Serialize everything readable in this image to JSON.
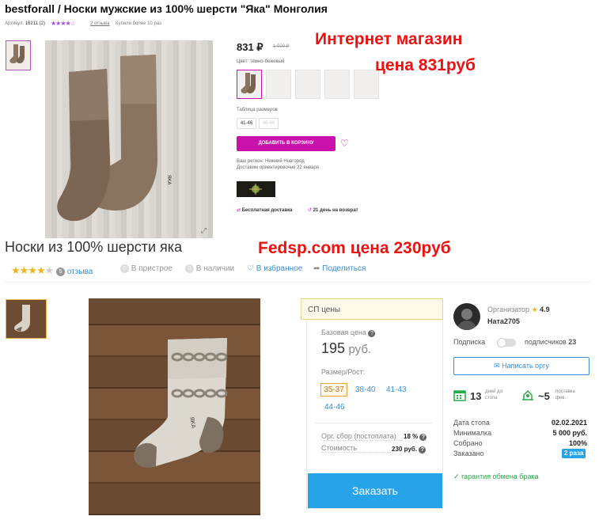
{
  "wb": {
    "title": "bestforall / Носки мужские из 100% шерсти \"Яка\" Монголия",
    "article_label": "Артикул:",
    "article_value": "16211 (2)",
    "reviews_link": "2 отзыва",
    "bought_label": "Купили более 10 раз",
    "price": "831 ₽",
    "old_price": "1 000 ₽",
    "color_label": "Цвет: темно-бежевый",
    "size_table_label": "Таблица размеров",
    "sizes": [
      "41-46",
      "46-48"
    ],
    "add_to_cart": "ДОБАВИТЬ В КОРЗИНУ",
    "region_line": "Ваш регион: Нижний Новгород",
    "delivery_line": "Доставим ориентировочно 22 января",
    "free_delivery": "Бесплатная доставка",
    "return_days": "21 день на возврат",
    "colors": {
      "accent": "#cb11ab"
    }
  },
  "annotations": {
    "shop_line1": "Интернет магазин",
    "shop_line2": "цена 831руб",
    "fedsp_line": "Fedsp.com    цена 230руб"
  },
  "fedsp": {
    "product_title": "Носки из 100% шерсти яка",
    "reviews_count": "5",
    "reviews_label": "отзыва",
    "pristroy_count": "0",
    "pristroy_label": "В пристрое",
    "stock_count": "0",
    "stock_label": "В наличии",
    "favorites_label": "В избранное",
    "share_label": "Поделиться",
    "sp_prices_label": "СП цены",
    "base_price_label": "Базовая цена",
    "base_price_value": "195",
    "base_price_unit": "руб.",
    "size_label": "Размер/Рост:",
    "sizes": [
      "35-37",
      "38-40",
      "41-43",
      "44-46"
    ],
    "org_fee_label": "Орг. сбор (постоплата)",
    "org_fee_value": "18 %",
    "cost_label": "Стоимость",
    "cost_value": "230 руб.",
    "order_button": "Заказать",
    "organizer_label": "Организатор",
    "organizer_rating": "4.9",
    "organizer_name": "Ната2705",
    "subscribe_label": "Подписка",
    "subscribers_label": "подписчиков",
    "subscribers_count": "23",
    "write_org": "Написать оргу",
    "days_to_stop_value": "13",
    "days_to_stop_label1": "дней до",
    "days_to_stop_label2": "стопа",
    "delivery_value": "~5",
    "delivery_label1": "поставка",
    "delivery_label2": "фев.",
    "stats": [
      {
        "label": "Дата стопа",
        "value": "02.02.2021"
      },
      {
        "label": "Минималка",
        "value": "5 000 руб."
      },
      {
        "label": "Собрано",
        "value": "100%"
      },
      {
        "label": "Заказано",
        "value": "2 раза"
      }
    ],
    "guarantee": "гарантия обмена брака",
    "colors": {
      "accent": "#27a3ea",
      "selected_size": "#e8a23a"
    }
  }
}
